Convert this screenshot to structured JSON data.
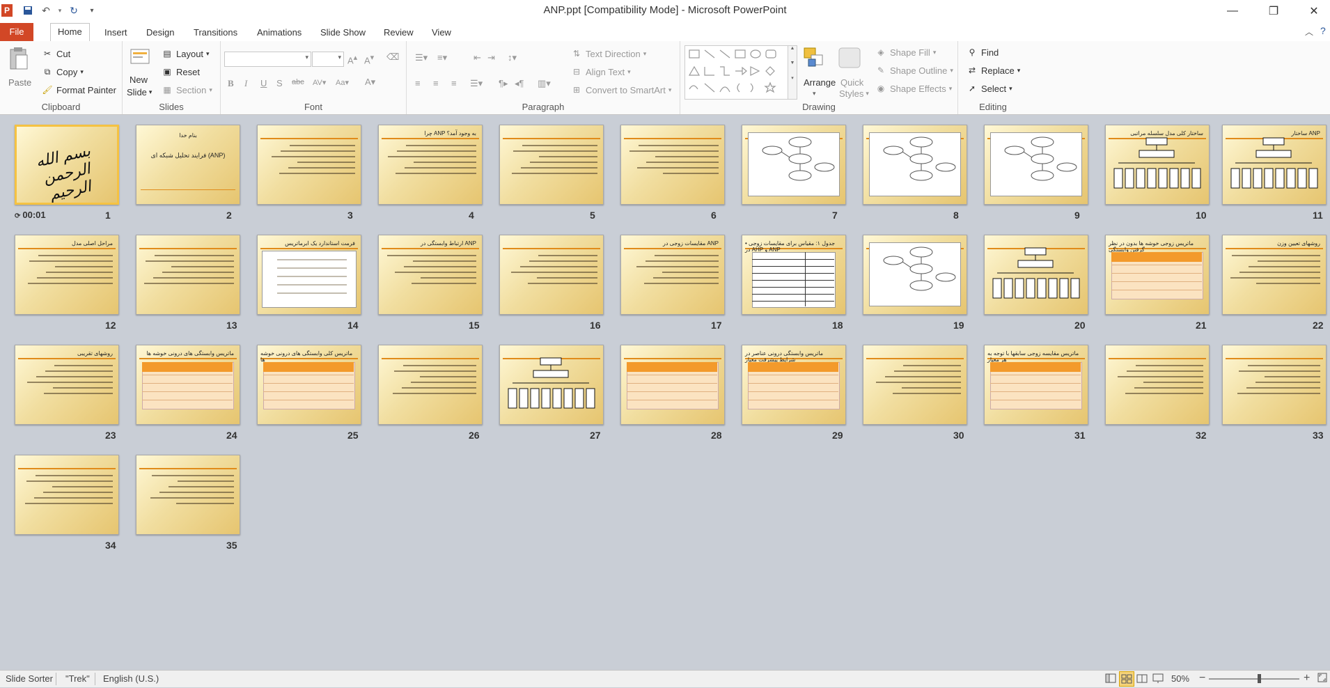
{
  "window": {
    "title": "ANP.ppt [Compatibility Mode]  -  Microsoft PowerPoint"
  },
  "qat": {
    "icons": [
      "powerpoint-logo-icon",
      "save-icon",
      "undo-icon",
      "redo-icon",
      "customize-icon"
    ]
  },
  "tabs": [
    "File",
    "Home",
    "Insert",
    "Design",
    "Transitions",
    "Animations",
    "Slide Show",
    "Review",
    "View"
  ],
  "ribbon": {
    "clipboard": {
      "paste": "Paste",
      "cut": "Cut",
      "copy": "Copy",
      "format_painter": "Format Painter",
      "label": "Clipboard"
    },
    "slides": {
      "new_slide_1": "New",
      "new_slide_2": "Slide",
      "layout": "Layout",
      "reset": "Reset",
      "section": "Section",
      "label": "Slides"
    },
    "font": {
      "label": "Font",
      "font_name": "",
      "font_size": ""
    },
    "paragraph": {
      "text_direction": "Text Direction",
      "align_text": "Align Text",
      "convert": "Convert to SmartArt",
      "label": "Paragraph"
    },
    "drawing": {
      "arrange": "Arrange",
      "quick_1": "Quick",
      "quick_2": "Styles",
      "shape_fill": "Shape Fill",
      "shape_outline": "Shape Outline",
      "shape_effects": "Shape Effects",
      "label": "Drawing"
    },
    "editing": {
      "find": "Find",
      "replace": "Replace",
      "select": "Select",
      "label": "Editing"
    }
  },
  "slides": [
    {
      "n": "1",
      "title": ""
    },
    {
      "n": "2",
      "title": ""
    },
    {
      "n": "3",
      "title": ""
    },
    {
      "n": "4",
      "title": "چرا ANP به وجود آمد؟"
    },
    {
      "n": "5",
      "title": ""
    },
    {
      "n": "6",
      "title": ""
    },
    {
      "n": "7",
      "title": ""
    },
    {
      "n": "8",
      "title": ""
    },
    {
      "n": "9",
      "title": ""
    },
    {
      "n": "10",
      "title": "ساختار کلی مدل سلسله مراتبی"
    },
    {
      "n": "11",
      "title": "ساختار ANP"
    },
    {
      "n": "12",
      "title": "مراحل اصلی مدل"
    },
    {
      "n": "13",
      "title": ""
    },
    {
      "n": "14",
      "title": "فرمت استاندارد یک ابرماتریس"
    },
    {
      "n": "15",
      "title": "ارتباط وابستگی در ANP"
    },
    {
      "n": "16",
      "title": ""
    },
    {
      "n": "17",
      "title": "مقایسات زوجی در ANP"
    },
    {
      "n": "18",
      "title": "• جدول ۱: مقیاس برای مقایسات زوجی در AHP و ANP"
    },
    {
      "n": "19",
      "title": ""
    },
    {
      "n": "20",
      "title": ""
    },
    {
      "n": "21",
      "title": "ماتریس زوجی خوشه ها بدون در نظر گرفتن وابستگی"
    },
    {
      "n": "22",
      "title": "روشهای تعیین وزن"
    },
    {
      "n": "23",
      "title": "روشهای تقریبی"
    },
    {
      "n": "24",
      "title": "ماتریس وابستگی های درونی خوشه ها"
    },
    {
      "n": "25",
      "title": "ماتریس کلی وابستگی های درونی خوشه ها"
    },
    {
      "n": "26",
      "title": ""
    },
    {
      "n": "27",
      "title": ""
    },
    {
      "n": "28",
      "title": ""
    },
    {
      "n": "29",
      "title": "ماتریس وابستگی درونی عناصر در شرایط پیشرفت معیار"
    },
    {
      "n": "30",
      "title": ""
    },
    {
      "n": "31",
      "title": "ماتریس مقایسه زوجی سابقها با توجه به هر معیار"
    },
    {
      "n": "32",
      "title": ""
    },
    {
      "n": "33",
      "title": ""
    },
    {
      "n": "34",
      "title": ""
    },
    {
      "n": "35",
      "title": ""
    }
  ],
  "slide1_timing": "00:01",
  "slide1_calligraphy": "بسم الله الرحمن الرحیم",
  "slide2": {
    "line1": "بنام خدا",
    "line2": "فرایند تحلیل شبکه ای (ANP)"
  },
  "status": {
    "view": "Slide Sorter",
    "theme": "\"Trek\"",
    "language": "English (U.S.)",
    "zoom": "50%",
    "zoom_level": 0.5
  }
}
